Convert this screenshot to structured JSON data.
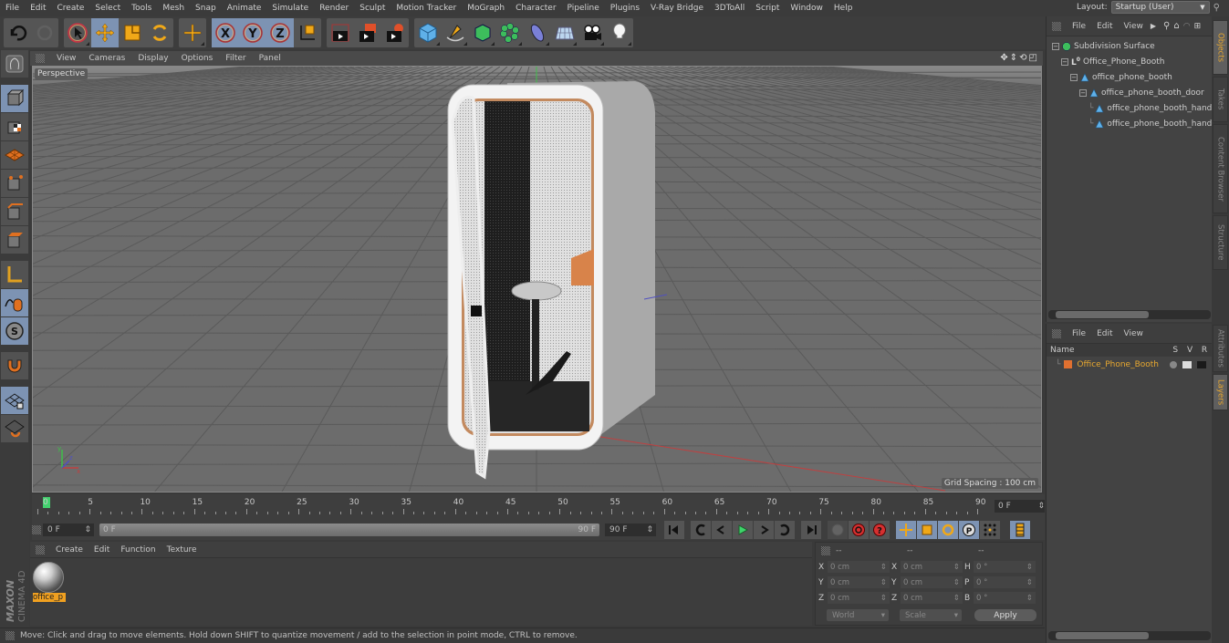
{
  "menubar": {
    "items": [
      "File",
      "Edit",
      "Create",
      "Select",
      "Tools",
      "Mesh",
      "Snap",
      "Animate",
      "Simulate",
      "Render",
      "Sculpt",
      "Motion Tracker",
      "MoGraph",
      "Character",
      "Pipeline",
      "Plugins",
      "V-Ray Bridge",
      "3DToAll",
      "Script",
      "Window",
      "Help"
    ],
    "layout_label": "Layout:",
    "layout_value": "Startup (User)"
  },
  "toolbar": {
    "tools": [
      {
        "name": "undo",
        "icon": "undo-icon"
      },
      {
        "name": "redo",
        "icon": "redo-icon"
      },
      {
        "name": "live-selection",
        "icon": "select-arrow-icon"
      },
      {
        "name": "move",
        "icon": "move-icon",
        "selected": true
      },
      {
        "name": "scale",
        "icon": "scale-icon"
      },
      {
        "name": "rotate",
        "icon": "rotate-icon"
      },
      {
        "name": "recent-tool",
        "icon": "move-plus-icon"
      },
      {
        "name": "x-axis",
        "icon": "x-axis-icon",
        "selected": true
      },
      {
        "name": "y-axis",
        "icon": "y-axis-icon",
        "selected": true
      },
      {
        "name": "z-axis",
        "icon": "z-axis-icon",
        "selected": true
      },
      {
        "name": "coordinate-system",
        "icon": "world-coords-icon"
      },
      {
        "name": "render-view",
        "icon": "render-view-icon"
      },
      {
        "name": "render-picture-viewer",
        "icon": "render-picture-icon"
      },
      {
        "name": "render-settings",
        "icon": "render-settings-icon"
      },
      {
        "name": "cube",
        "icon": "cube-icon"
      },
      {
        "name": "pen",
        "icon": "pen-icon"
      },
      {
        "name": "subdivision-surface",
        "icon": "subdivision-icon"
      },
      {
        "name": "cloner",
        "icon": "cloner-icon"
      },
      {
        "name": "deformer",
        "icon": "deformer-icon"
      },
      {
        "name": "floor",
        "icon": "floor-icon"
      },
      {
        "name": "camera",
        "icon": "camera-icon"
      },
      {
        "name": "light",
        "icon": "light-icon"
      }
    ]
  },
  "left_tools": [
    {
      "name": "model-mode",
      "selected": true
    },
    {
      "name": "texture-mode"
    },
    {
      "name": "workplane-mode"
    },
    {
      "name": "points-mode"
    },
    {
      "name": "edges-mode"
    },
    {
      "name": "polygons-mode"
    },
    {
      "name": "axis-mode"
    },
    {
      "name": "tweak-mode",
      "selected": true
    },
    {
      "name": "solo-mode",
      "selected": true
    },
    {
      "name": "snap-mode"
    },
    {
      "name": "lock-workplane",
      "selected": true
    },
    {
      "name": "planar-workplane"
    }
  ],
  "viewport": {
    "menu": [
      "View",
      "Cameras",
      "Display",
      "Options",
      "Filter",
      "Panel"
    ],
    "camera_label": "Perspective",
    "grid_spacing": "Grid Spacing : 100 cm"
  },
  "timeline": {
    "ticks": [
      0,
      5,
      10,
      15,
      20,
      25,
      30,
      35,
      40,
      45,
      50,
      55,
      60,
      65,
      70,
      75,
      80,
      85,
      90
    ],
    "current_frame": "0 F",
    "max_frame": 90
  },
  "transport": {
    "start_field": "0 F",
    "range_start": "0 F",
    "range_end": "90 F",
    "end_field": "90 F"
  },
  "materials": {
    "menu": [
      "Create",
      "Edit",
      "Function",
      "Texture"
    ],
    "items": [
      {
        "name": "office_p"
      }
    ]
  },
  "brand": {
    "line1": "MAXON",
    "line2": "CINEMA 4D"
  },
  "coordinates": {
    "headers": [
      "--",
      "--",
      "--"
    ],
    "rows": [
      {
        "l1": "X",
        "v1": "0 cm",
        "l2": "X",
        "v2": "0 cm",
        "l3": "H",
        "v3": "0 °"
      },
      {
        "l1": "Y",
        "v1": "0 cm",
        "l2": "Y",
        "v2": "0 cm",
        "l3": "P",
        "v3": "0 °"
      },
      {
        "l1": "Z",
        "v1": "0 cm",
        "l2": "Z",
        "v2": "0 cm",
        "l3": "B",
        "v3": "0 °"
      }
    ],
    "mode": "World",
    "transform": "Scale",
    "apply_label": "Apply"
  },
  "status": {
    "text": "Move: Click and drag to move elements. Hold down SHIFT to quantize movement / add to the selection in point mode, CTRL to remove."
  },
  "objects": {
    "menu": [
      "File",
      "Edit",
      "View"
    ],
    "tree": [
      {
        "label": "Subdivision Surface",
        "depth": 0,
        "icon": "subdivision-icon"
      },
      {
        "label": "Office_Phone_Booth",
        "depth": 1,
        "icon": "null-object-icon"
      },
      {
        "label": "office_phone_booth",
        "depth": 2,
        "icon": "polygon-object-icon"
      },
      {
        "label": "office_phone_booth_door",
        "depth": 3,
        "icon": "polygon-object-icon"
      },
      {
        "label": "office_phone_booth_handle",
        "depth": 4,
        "icon": "polygon-object-icon"
      },
      {
        "label": "office_phone_booth_handle",
        "depth": 4,
        "icon": "polygon-object-icon"
      }
    ]
  },
  "layers": {
    "menu": [
      "File",
      "Edit",
      "View"
    ],
    "columns": {
      "name": "Name",
      "s": "S",
      "v": "V",
      "r": "R"
    },
    "items": [
      {
        "label": "Office_Phone_Booth",
        "color": "#e07030"
      }
    ]
  },
  "side_tabs": {
    "top": [
      {
        "label": "Objects",
        "active": true
      },
      {
        "label": "Takes"
      },
      {
        "label": "Content Browser"
      },
      {
        "label": "Structure"
      }
    ],
    "bottom": [
      {
        "label": "Attributes"
      },
      {
        "label": "Layers",
        "active": true
      }
    ]
  },
  "colors": {
    "accent_selected": "#7d93b3",
    "highlight_orange": "#e8a830",
    "playhead_green": "#42d16e"
  }
}
